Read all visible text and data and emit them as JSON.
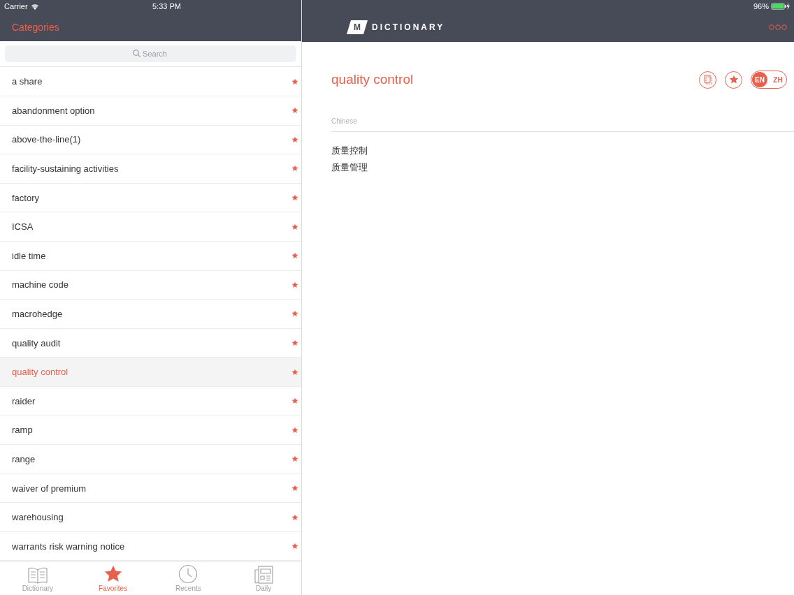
{
  "status_bar": {
    "carrier": "Carrier",
    "time": "5:33 PM",
    "battery": "96%"
  },
  "sidebar": {
    "title": "Categories",
    "search": {
      "placeholder": "Search"
    },
    "items": [
      {
        "label": "a share",
        "selected": false
      },
      {
        "label": "abandonment option",
        "selected": false
      },
      {
        "label": "above-the-line(1)",
        "selected": false
      },
      {
        "label": "facility-sustaining activities",
        "selected": false
      },
      {
        "label": "factory",
        "selected": false
      },
      {
        "label": "ICSA",
        "selected": false
      },
      {
        "label": "idle time",
        "selected": false
      },
      {
        "label": "machine code",
        "selected": false
      },
      {
        "label": "macrohedge",
        "selected": false
      },
      {
        "label": "quality audit",
        "selected": false
      },
      {
        "label": "quality control",
        "selected": true
      },
      {
        "label": "raider",
        "selected": false
      },
      {
        "label": "ramp",
        "selected": false
      },
      {
        "label": "range",
        "selected": false
      },
      {
        "label": "waiver of premium",
        "selected": false
      },
      {
        "label": "warehousing",
        "selected": false
      },
      {
        "label": "warrants risk warning notice",
        "selected": false
      }
    ]
  },
  "tab_bar": [
    {
      "label": "Dictionary",
      "kind": "book",
      "selected": false
    },
    {
      "label": "Favorites",
      "kind": "star",
      "selected": true
    },
    {
      "label": "Recents",
      "kind": "clock",
      "selected": false
    },
    {
      "label": "Daily",
      "kind": "news",
      "selected": false
    }
  ],
  "header": {
    "logo_letter": "M",
    "logo_text": "DICTIONARY"
  },
  "detail": {
    "term": "quality control",
    "section": "Chinese",
    "translations": [
      "质量控制",
      "质量管理"
    ],
    "language_toggle": [
      {
        "label": "EN",
        "selected": true
      },
      {
        "label": "ZH",
        "selected": false
      }
    ]
  }
}
